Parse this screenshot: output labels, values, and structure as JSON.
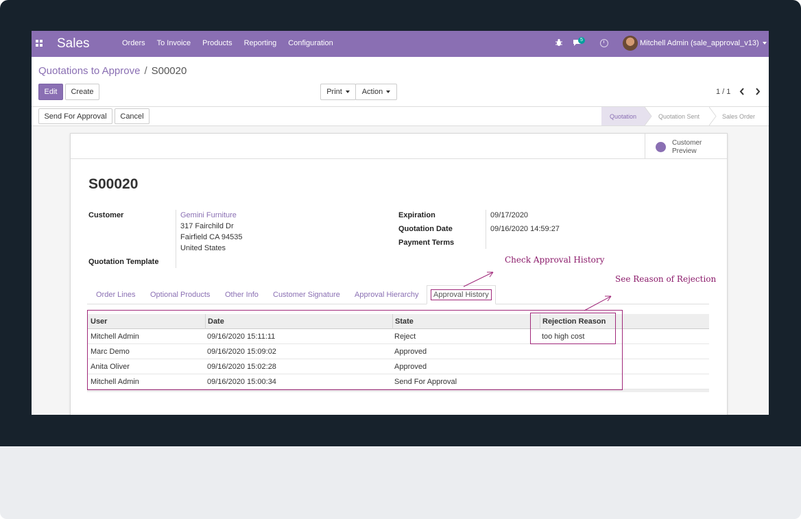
{
  "navbar": {
    "brand": "Sales",
    "menu": [
      "Orders",
      "To Invoice",
      "Products",
      "Reporting",
      "Configuration"
    ],
    "messages_count": "5",
    "user": "Mitchell Admin (sale_approval_v13)",
    "color": "#8a6fb3"
  },
  "breadcrumb": {
    "parent": "Quotations to Approve",
    "separator": "/",
    "current": "S00020"
  },
  "buttons": {
    "edit": "Edit",
    "create": "Create",
    "print": "Print",
    "action": "Action",
    "send_for_approval": "Send For Approval",
    "cancel": "Cancel"
  },
  "pager": "1 / 1",
  "stages": [
    "Quotation",
    "Quotation Sent",
    "Sales Order"
  ],
  "customer_preview": {
    "line1": "Customer",
    "line2": "Preview"
  },
  "record": {
    "name": "S00020",
    "customer_label": "Customer",
    "customer_name": "Gemini Furniture",
    "address": [
      "317 Fairchild Dr",
      "Fairfield CA 94535",
      "United States"
    ],
    "template_label": "Quotation Template",
    "expiration_label": "Expiration",
    "expiration": "09/17/2020",
    "quotation_date_label": "Quotation Date",
    "quotation_date": "09/16/2020 14:59:27",
    "payment_terms_label": "Payment Terms"
  },
  "tabs": [
    "Order Lines",
    "Optional Products",
    "Other Info",
    "Customer Signature",
    "Approval Hierarchy",
    "Approval History"
  ],
  "history": {
    "columns": [
      "User",
      "Date",
      "State",
      "Rejection Reason"
    ],
    "rows": [
      [
        "Mitchell Admin",
        "09/16/2020 15:11:11",
        "Reject",
        "too high cost"
      ],
      [
        "Marc Demo",
        "09/16/2020 15:09:02",
        "Approved",
        ""
      ],
      [
        "Anita Oliver",
        "09/16/2020 15:02:28",
        "Approved",
        ""
      ],
      [
        "Mitchell Admin",
        "09/16/2020 15:00:34",
        "Send For Approval",
        ""
      ]
    ]
  },
  "annotations": {
    "check_history": "Check Approval History",
    "see_reason": "See Reason of Rejection",
    "color": "#a0287a"
  }
}
